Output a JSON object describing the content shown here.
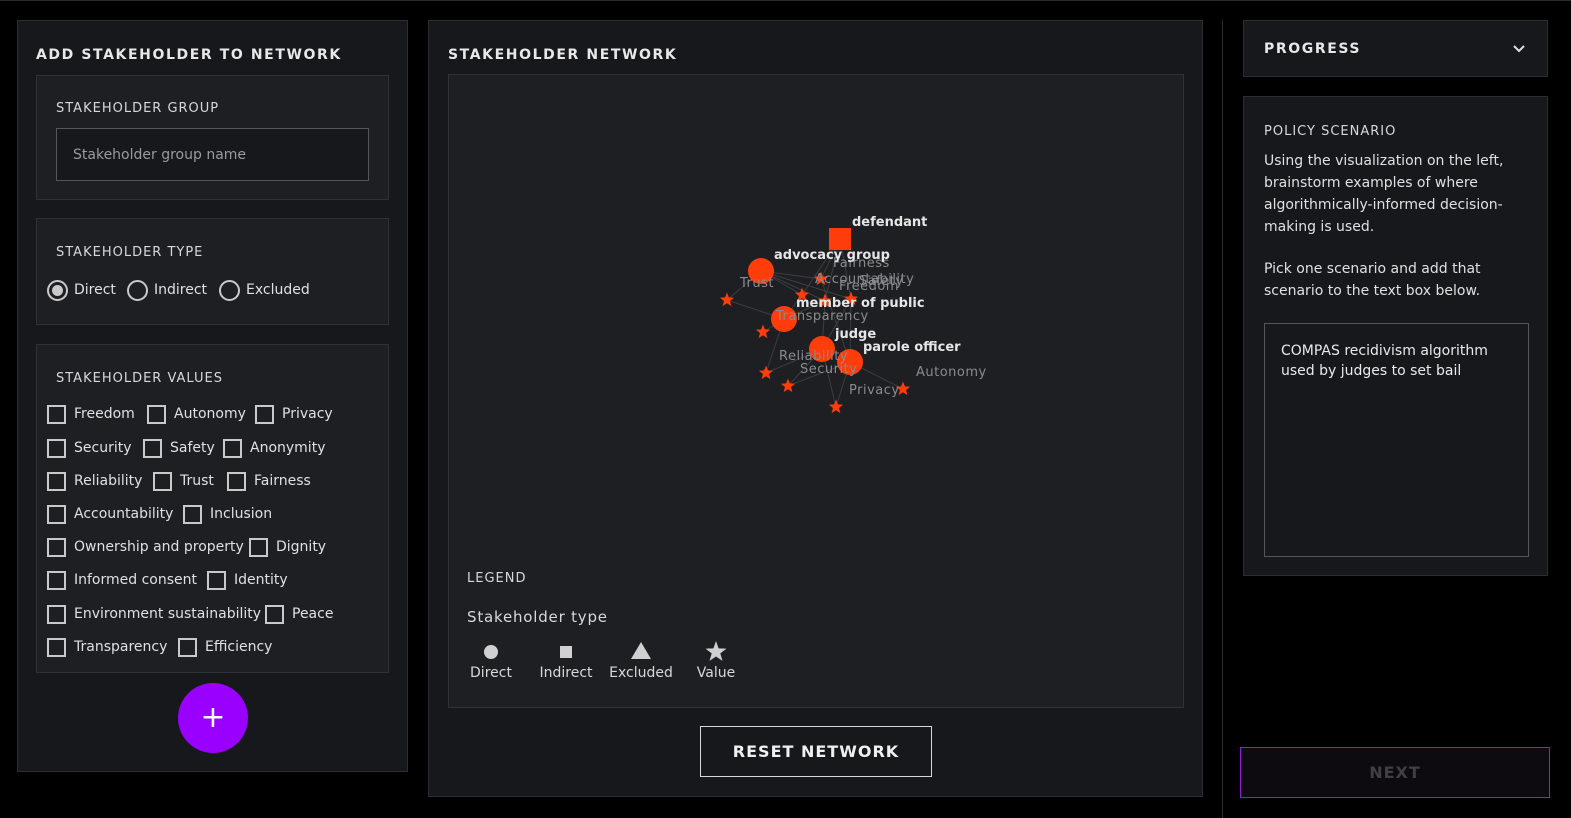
{
  "left": {
    "title": "ADD STAKEHOLDER TO NETWORK",
    "group_label": "STAKEHOLDER GROUP",
    "group_placeholder": "Stakeholder group name",
    "group_value": "",
    "type_label": "STAKEHOLDER TYPE",
    "types": [
      {
        "label": "Direct",
        "selected": true
      },
      {
        "label": "Indirect",
        "selected": false
      },
      {
        "label": "Excluded",
        "selected": false
      }
    ],
    "values_label": "STAKEHOLDER VALUES",
    "values": [
      "Freedom",
      "Autonomy",
      "Privacy",
      "Security",
      "Safety",
      "Anonymity",
      "Reliability",
      "Trust",
      "Fairness",
      "Accountability",
      "Inclusion",
      "Ownership and property",
      "Dignity",
      "Informed consent",
      "Identity",
      "Environment sustainability",
      "Peace",
      "Transparency",
      "Efficiency"
    ],
    "add_button": "+"
  },
  "network": {
    "title": "STAKEHOLDER NETWORK",
    "node_color": "#ff3d0a",
    "stakeholders": [
      {
        "name": "defendant",
        "type": "Indirect"
      },
      {
        "name": "advocacy group",
        "type": "Direct"
      },
      {
        "name": "member of public",
        "type": "Direct"
      },
      {
        "name": "judge",
        "type": "Direct"
      },
      {
        "name": "parole officer",
        "type": "Direct"
      }
    ],
    "value_nodes": [
      "Fairness",
      "Accountability",
      "Safety",
      "Freedom",
      "Trust",
      "Transparency",
      "Reliability",
      "Security",
      "Privacy",
      "Autonomy"
    ],
    "legend": {
      "title": "LEGEND",
      "subtitle": "Stakeholder type",
      "items": [
        {
          "label": "Direct",
          "icon": "circle-icon"
        },
        {
          "label": "Indirect",
          "icon": "square-icon"
        },
        {
          "label": "Excluded",
          "icon": "triangle-icon"
        },
        {
          "label": "Value",
          "icon": "star-icon"
        }
      ]
    },
    "reset_button": "RESET NETWORK"
  },
  "progress": {
    "title": "PROGRESS"
  },
  "scenario": {
    "title": "POLICY SCENARIO",
    "paragraph1": "Using the visualization on the left, brainstorm examples of where algorithmically-informed decision-making is used.",
    "paragraph2": "Pick one scenario and add that scenario to the text box below.",
    "text_value": "COMPAS recidivism algorithm used by judges to set bail"
  },
  "next_button": "NEXT",
  "colors": {
    "accent_purple": "#9a00ff",
    "node_orange": "#ff3d0a",
    "background": "#000000",
    "panel": "#17181b"
  }
}
